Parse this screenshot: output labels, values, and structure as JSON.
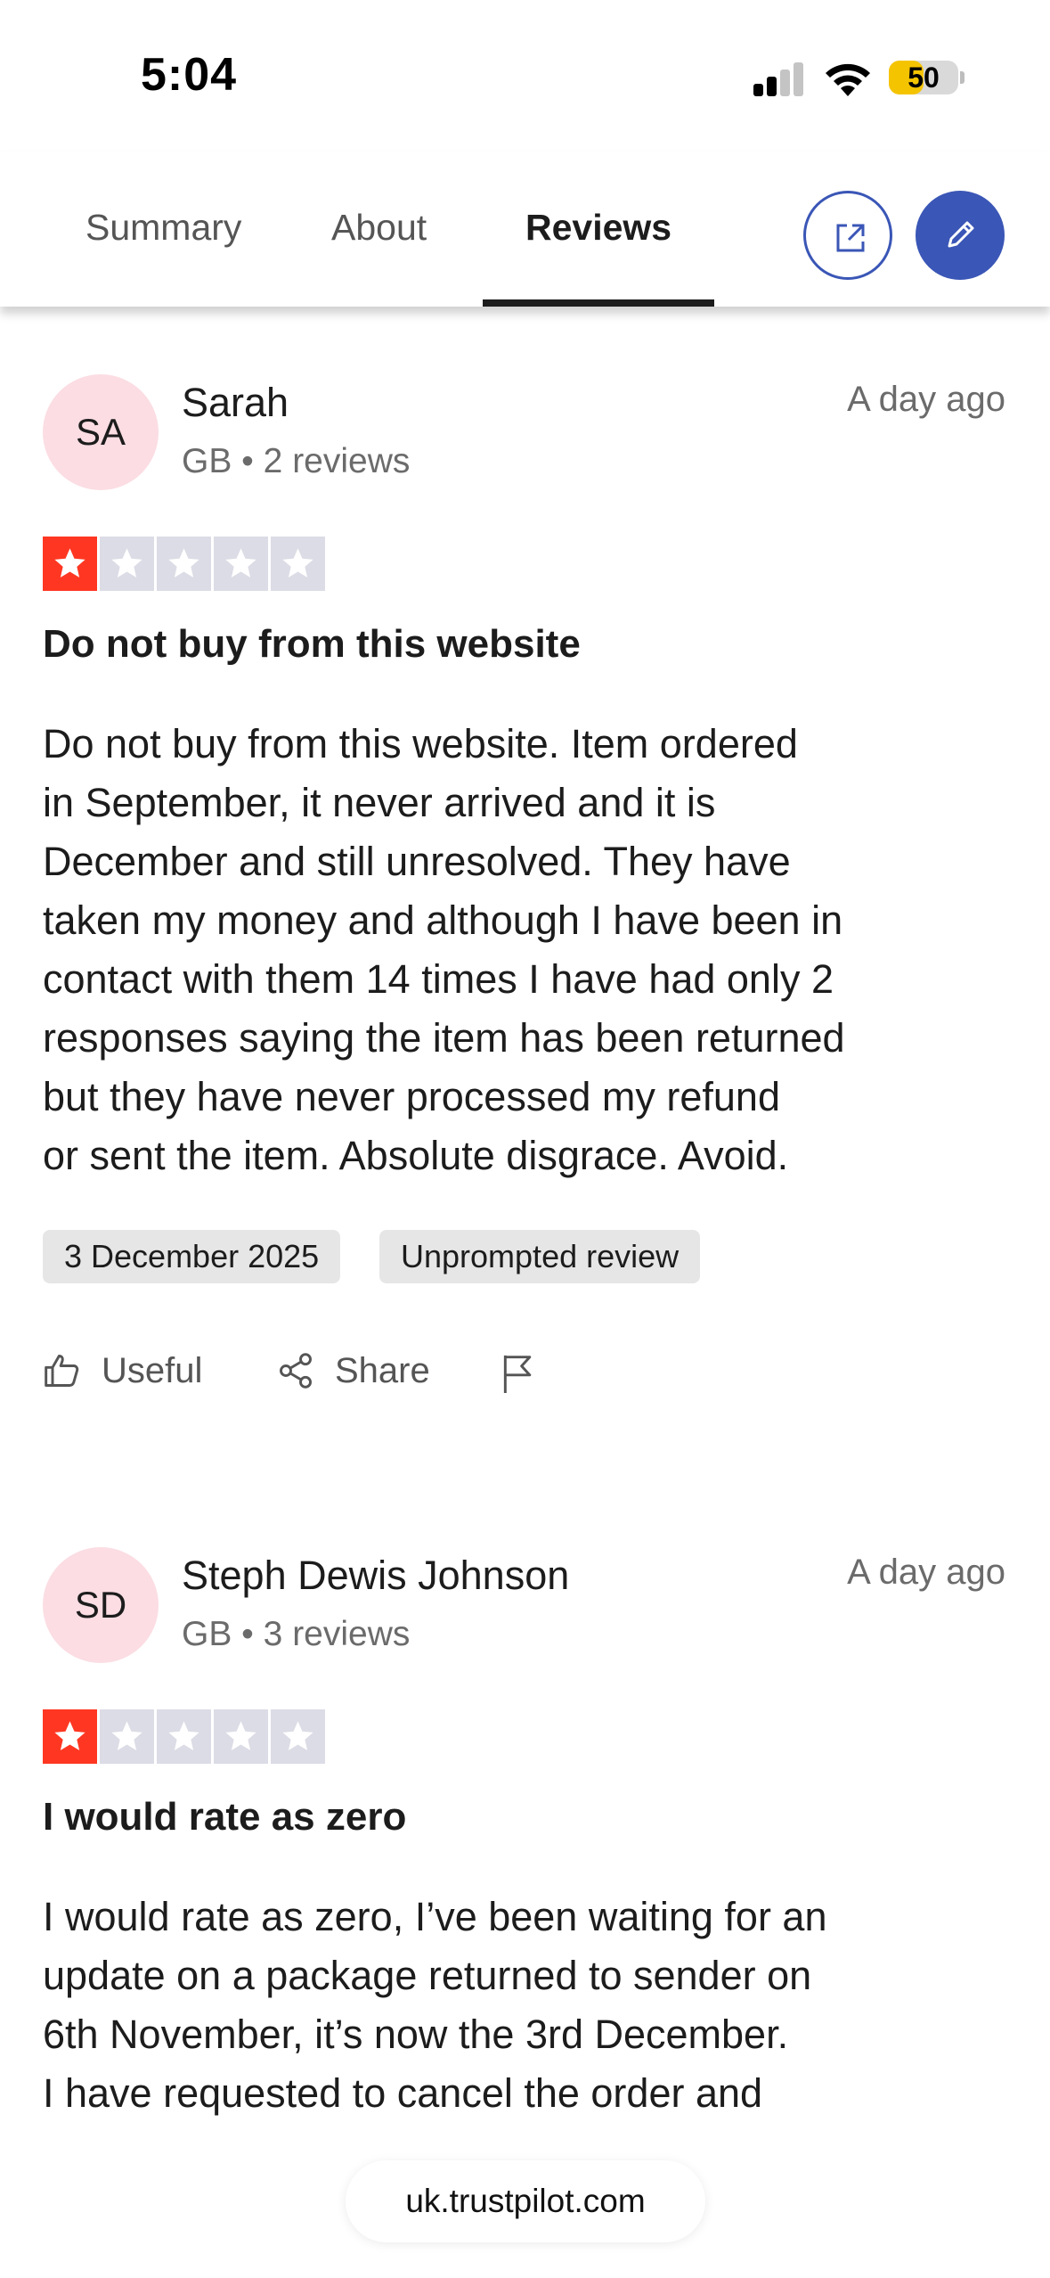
{
  "status_bar": {
    "time": "5:04",
    "battery": "50",
    "battery_level": 0.5
  },
  "tabs": [
    {
      "label": "Summary",
      "active": false
    },
    {
      "label": "About",
      "active": false
    },
    {
      "label": "Reviews",
      "active": true
    }
  ],
  "header_actions": {
    "open_external_icon": "external-link-icon",
    "write_review_icon": "pencil-icon",
    "accent_color": "#3a56b6"
  },
  "reviews": [
    {
      "initials": "SA",
      "name": "Sarah",
      "meta": "GB • 2 reviews",
      "date": "A day ago",
      "rating": 1,
      "title": "Do not buy from this website",
      "body_lines": [
        "Do not buy from this website. Item ordered",
        "in September, it never arrived and it is",
        "December and still unresolved. They have",
        "taken my money and although I have been in",
        "contact with them 14 times I have had only 2",
        "responses saying the item has been returned",
        "but they have never processed my refund",
        "or sent the item. Absolute disgrace. Avoid."
      ],
      "chips": [
        "3 December 2025",
        "Unprompted review"
      ],
      "actions": {
        "useful": "Useful",
        "share": "Share"
      }
    },
    {
      "initials": "SD",
      "name": "Steph Dewis Johnson",
      "meta": "GB • 3 reviews",
      "date": "A day ago",
      "rating": 1,
      "title": "I would rate as zero",
      "body_lines": [
        "I would rate as zero, I’ve been waiting for an",
        "update on a package returned to sender on",
        "6th November, it’s now the 3rd December.",
        "I have requested to cancel the order and"
      ]
    }
  ],
  "colors": {
    "star_filled": "#ff3722",
    "star_empty": "#dcdce6",
    "avatar_bg": "#fbdde3"
  },
  "url": "uk.trustpilot.com"
}
